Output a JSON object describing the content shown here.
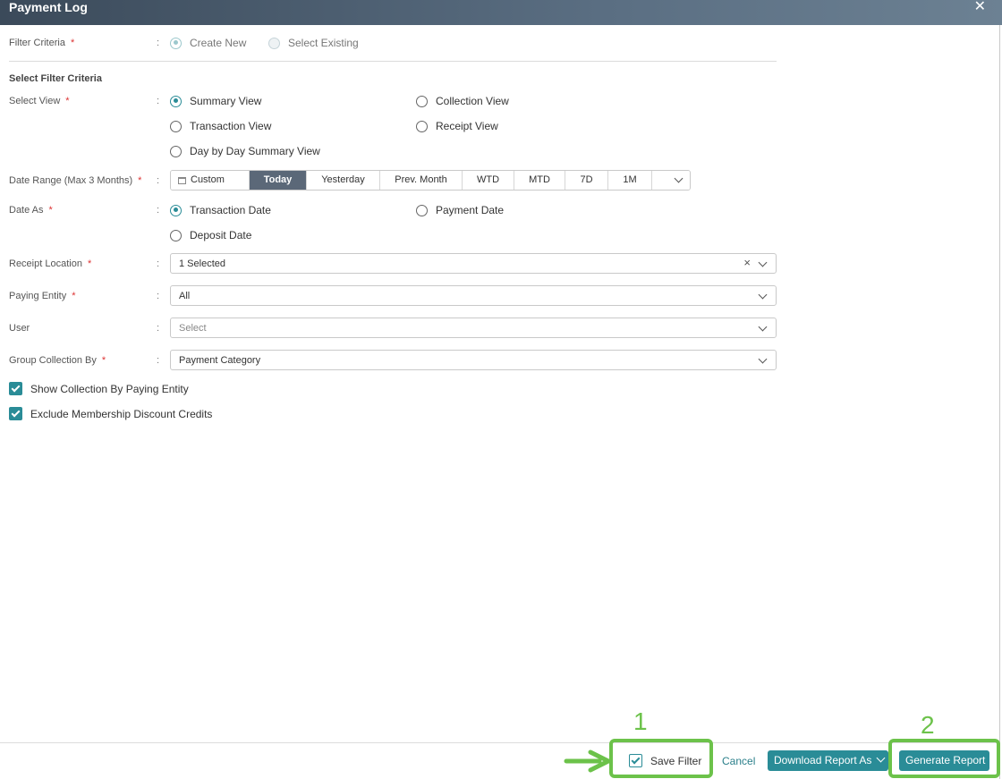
{
  "header": {
    "title": "Payment Log",
    "close_glyph": "✕"
  },
  "filter_criteria": {
    "label": "Filter Criteria",
    "required": "*",
    "options": [
      {
        "label": "Create New",
        "selected": true
      },
      {
        "label": "Select Existing",
        "selected": false
      }
    ]
  },
  "section_title": "Select Filter Criteria",
  "colon": ":",
  "select_view": {
    "label": "Select View",
    "required": "*",
    "options": [
      {
        "label": "Summary View",
        "selected": true
      },
      {
        "label": "Collection View",
        "selected": false
      },
      {
        "label": "Transaction View",
        "selected": false
      },
      {
        "label": "Receipt View",
        "selected": false
      },
      {
        "label": "Day by Day Summary View",
        "selected": false
      }
    ]
  },
  "date_range": {
    "label": "Date Range (Max 3 Months)",
    "required": "*",
    "buttons": [
      "Custom",
      "Today",
      "Yesterday",
      "Prev. Month",
      "WTD",
      "MTD",
      "7D",
      "1M"
    ],
    "active": "Today"
  },
  "date_as": {
    "label": "Date As",
    "required": "*",
    "options": [
      {
        "label": "Transaction Date",
        "selected": true
      },
      {
        "label": "Payment Date",
        "selected": false
      },
      {
        "label": "Deposit Date",
        "selected": false
      }
    ]
  },
  "receipt_location": {
    "label": "Receipt Location",
    "required": "*",
    "value": "1 Selected"
  },
  "paying_entity": {
    "label": "Paying Entity",
    "required": "*",
    "value": "All"
  },
  "user": {
    "label": "User",
    "placeholder": "Select"
  },
  "group_collection_by": {
    "label": "Group Collection By",
    "required": "*",
    "value": "Payment Category"
  },
  "checkboxes": {
    "show_collection": {
      "label": "Show Collection By Paying Entity",
      "checked": true
    },
    "exclude_membership": {
      "label": "Exclude Membership Discount Credits",
      "checked": true
    }
  },
  "footer": {
    "save_filter": {
      "label": "Save Filter",
      "checked": true
    },
    "cancel": "Cancel",
    "download": "Download Report As",
    "generate": "Generate Report"
  },
  "annotations": {
    "step1": "1",
    "step2": "2",
    "color": "#6cc24a"
  },
  "colors": {
    "accent": "#2a8c97",
    "header": "#4a5a6b",
    "required": "#dd3333"
  }
}
